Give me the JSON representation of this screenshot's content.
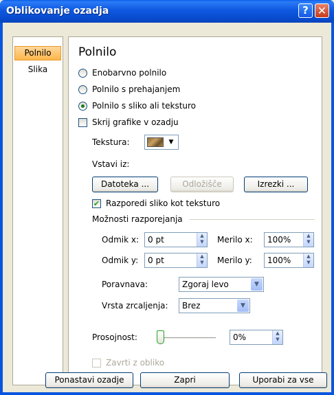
{
  "window": {
    "title": "Oblikovanje ozadja"
  },
  "titlebar": {
    "help_glyph": "?",
    "close_glyph": "✕"
  },
  "sidebar": {
    "items": [
      {
        "label": "Polnilo"
      },
      {
        "label": "Slika"
      }
    ]
  },
  "panel": {
    "heading": "Polnilo",
    "fill_options": [
      {
        "label": "Enobarvno polnilo",
        "checked": false
      },
      {
        "label": "Polnilo s prehajanjem",
        "checked": false
      },
      {
        "label": "Polnilo s sliko ali teksturo",
        "checked": true
      }
    ],
    "hide_graphics": {
      "label": "Skrij grafike v ozadju",
      "checked": false
    },
    "texture": {
      "label": "Tekstura:",
      "dropdown_arrow": "▼"
    },
    "insert_from": {
      "label": "Vstavi iz:",
      "buttons": [
        {
          "label": "Datoteka ...",
          "enabled": true
        },
        {
          "label": "Odložišče",
          "enabled": false
        },
        {
          "label": "Izrezki ...",
          "enabled": true
        }
      ]
    },
    "tile_as_texture": {
      "label": "Razporedi sliko kot teksturo",
      "checked": true
    },
    "tiling_options": {
      "label": "Možnosti razporejanja",
      "offset_x": {
        "label": "Odmik x:",
        "value": "0 pt"
      },
      "scale_x": {
        "label": "Merilo x:",
        "value": "100%"
      },
      "offset_y": {
        "label": "Odmik y:",
        "value": "0 pt"
      },
      "scale_y": {
        "label": "Merilo y:",
        "value": "100%"
      },
      "alignment": {
        "label": "Poravnava:",
        "value": "Zgoraj levo"
      },
      "mirror_type": {
        "label": "Vrsta zrcaljenja:",
        "value": "Brez"
      }
    },
    "transparency": {
      "label": "Prosojnost:",
      "value": "0%",
      "level": 0
    },
    "rotate_with_shape": {
      "label": "Zavrti z obliko",
      "checked": false,
      "enabled": false
    }
  },
  "footer": {
    "reset_label": "Ponastavi ozadje",
    "close_label": "Zapri",
    "apply_all_label": "Uporabi za vse"
  },
  "icons": {
    "spin_up": "▲",
    "spin_down": "▼",
    "dropdown": "▼",
    "checkmark": "✔"
  }
}
